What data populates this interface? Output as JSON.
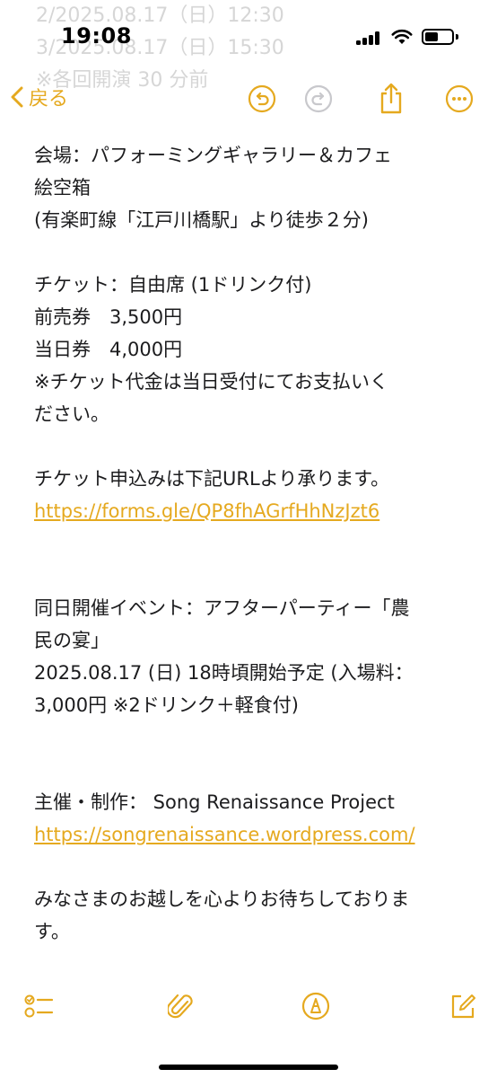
{
  "status_bar": {
    "time": "19:08",
    "battery_percent": 20
  },
  "ghost_lines": [
    "2/2025.08.17（日）12:30",
    "3/2025.08.17（日）15:30",
    "※各回開演 30 分前"
  ],
  "nav": {
    "back_label": "戻る"
  },
  "note": {
    "lines": [
      {
        "text": "会場：パフォーミングギャラリー＆カフェ"
      },
      {
        "text": "絵空箱"
      },
      {
        "text": "(有楽町線「江戸川橋駅」より徒歩２分)"
      },
      {
        "text": ""
      },
      {
        "text": "チケット：自由席 (1ドリンク付)"
      },
      {
        "text": "前売券　3,500円"
      },
      {
        "text": "当日券　4,000円"
      },
      {
        "text": "※チケット代金は当日受付にてお支払いく"
      },
      {
        "text": "ださい。"
      },
      {
        "text": ""
      },
      {
        "text": "チケット申込みは下記URLより承ります。"
      },
      {
        "text": "https://forms.gle/QP8fhAGrfHhNzJzt6",
        "link": true
      },
      {
        "text": ""
      },
      {
        "text": ""
      },
      {
        "text": "同日開催イベント：アフターパーティー「農"
      },
      {
        "text": "民の宴」"
      },
      {
        "text": "2025.08.17 (日) 18時頃開始予定 (入場料："
      },
      {
        "text": "3,000円 ※2ドリンク＋軽食付)"
      },
      {
        "text": ""
      },
      {
        "text": ""
      },
      {
        "text": "主催・制作： Song Renaissance Project"
      },
      {
        "text": "https://songrenaissance.wordpress.com/",
        "link": true
      },
      {
        "text": ""
      },
      {
        "text": "みなさまのお越しを心よりお待ちしておりま"
      },
      {
        "text": "す。"
      }
    ]
  },
  "colors": {
    "accent": "#e5a91f",
    "text": "#1c1c1e"
  },
  "icons": {
    "nav": [
      "back-chevron-icon",
      "undo-icon",
      "redo-icon",
      "share-icon",
      "more-icon"
    ],
    "toolbar": [
      "checklist-icon",
      "attachment-icon",
      "markup-icon",
      "compose-icon"
    ]
  }
}
